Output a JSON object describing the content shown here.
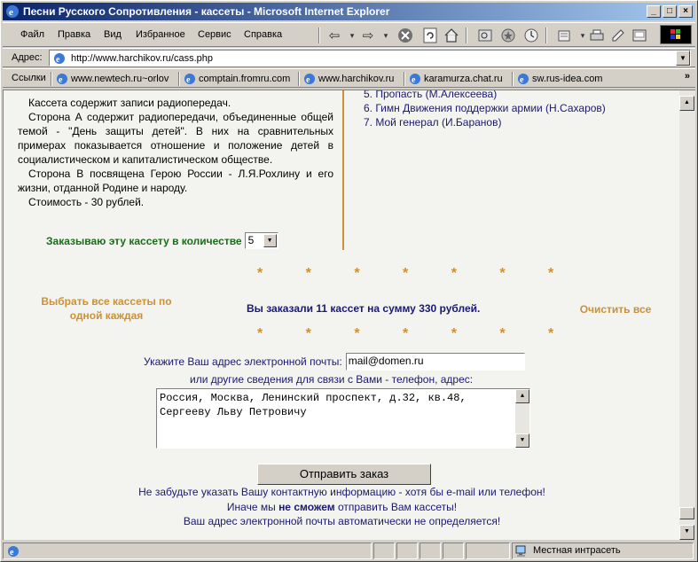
{
  "window": {
    "title": "Песни Русского Сопротивления - кассеты - Microsoft Internet Explorer"
  },
  "menu": {
    "file": "Файл",
    "edit": "Правка",
    "view": "Вид",
    "favorites": "Избранное",
    "tools": "Сервис",
    "help": "Справка"
  },
  "address": {
    "label": "Адрес:",
    "url": "http://www.harchikov.ru/cass.php"
  },
  "links": {
    "label": "Ссылки",
    "items": [
      "www.newtech.ru~orlov",
      "comptain.fromru.com",
      "www.harchikov.ru",
      "karamurza.chat.ru",
      "sw.rus-idea.com"
    ]
  },
  "cassette": {
    "paragraphs": [
      "Кассета содержит записи радиопередач.",
      "Сторона А содержит радиопередачи, объединенные общей темой - \"День защиты детей\". В них на сравнительных примерах показывается отношение и положение детей в социалистическом и капиталистическом обществе.",
      "Сторона В посвящена Герою России - Л.Я.Рохлину и его жизни, отданной Родине и народу.",
      "Стоимость - 30 рублей."
    ],
    "tracks": [
      "5. Пропасть (М.Алексеева)",
      "6. Гимн Движения поддержки армии (Н.Сахаров)",
      "7. Мой генерал (И.Баранов)"
    ],
    "order_label": "Заказываю эту кассету в количестве",
    "quantity": "5"
  },
  "order": {
    "stars": "* * * * * * *",
    "select_all": "Выбрать все кассеты по одной каждая",
    "summary": "Вы заказали 11 кассет на сумму 330 рублей.",
    "clear_all": "Очистить все",
    "email_label": "Укажите Ваш адрес электронной почты:",
    "email_value": "mail@domen.ru",
    "other_label": "или другие сведения для связи с Вами - телефон, адрес:",
    "contact_value": "Россия, Москва, Ленинский проспект, д.32, кв.48,\nСергееву Льву Петровичу",
    "submit_label": "Отправить заказ",
    "note1": "Не забудьте указать Вашу контактную информацию - хотя бы e-mail или телефон!",
    "note2_pre": "Иначе мы",
    "note2_bold": "не сможем",
    "note2_post": "отправить Вам кассеты!",
    "note3": "Ваш адрес электронной почты автоматически не определяется!"
  },
  "status": {
    "zone": "Местная интрасеть"
  },
  "colors": {
    "accent_orange": "#c9913a",
    "navy_text": "#1a1a6e",
    "green_text": "#1b6b1b",
    "titlebar": "#0a246a"
  }
}
